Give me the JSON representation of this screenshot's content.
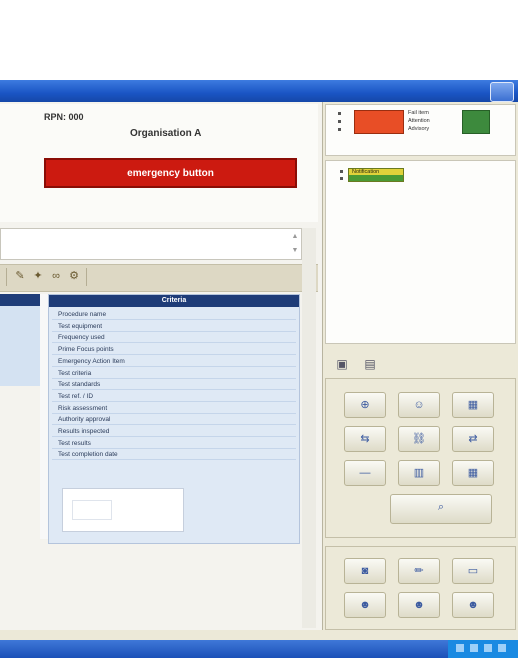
{
  "header": {
    "rpn": "RPN: 000",
    "organization": "Organisation A",
    "emergency_button": "emergency button"
  },
  "toolbar": {
    "icons": [
      "edit-icon",
      "pin-icon",
      "binoculars-icon",
      "wrench-icon"
    ]
  },
  "list": {
    "header": "Criteria",
    "items": [
      "Procedure name",
      "Test equipment",
      "Frequency used",
      "Prime Focus points",
      "Emergency Action Item",
      "Test criteria",
      "Test standards",
      "Test ref. / ID",
      "Risk assessment",
      "Authority approval",
      "Results inspected",
      "Test results",
      "Test completion date"
    ]
  },
  "legend": {
    "red_label": "",
    "items": [
      "Fail item",
      "Attention",
      "Advisory"
    ],
    "green_label": "",
    "legend2_label": "Notification"
  },
  "colors": {
    "emergency": "#cc1a10",
    "title_bar": "#1a55c4",
    "list_header": "#1e3c78",
    "legend_red": "#e84e26",
    "legend_green": "#3d8a3d"
  },
  "tools": {
    "tabs": [
      "notes-icon",
      "image-icon"
    ],
    "buttons": [
      "zoom-in-icon",
      "user-icon",
      "save-icon",
      "move-icon",
      "link-icon",
      "compare-icon",
      "line-icon",
      "chart-icon",
      "grid-icon"
    ],
    "wide_button": "search-icon",
    "buttons2": [
      "camera-icon",
      "pencil-icon",
      "window-icon",
      "people-icon",
      "people2-icon",
      "people3-icon"
    ]
  },
  "status": {
    "left": "",
    "middle": "",
    "right": ""
  }
}
